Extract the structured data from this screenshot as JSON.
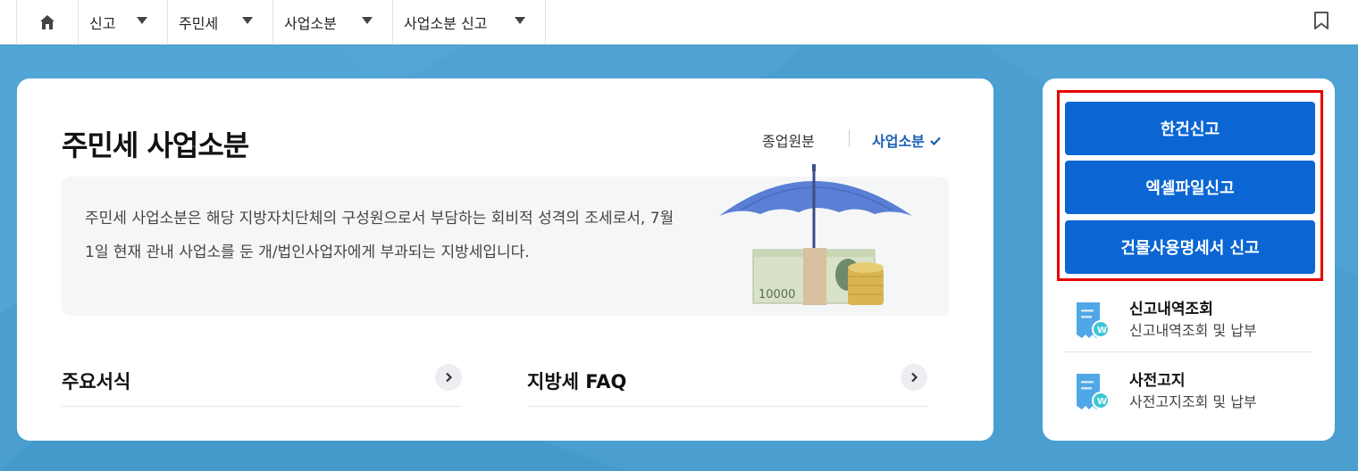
{
  "nav": {
    "items": [
      {
        "label": "신고"
      },
      {
        "label": "주민세"
      },
      {
        "label": "사업소분"
      },
      {
        "label": "사업소분 신고"
      }
    ]
  },
  "main": {
    "title": "주민세 사업소분",
    "tabs": [
      {
        "label": "종업원분",
        "selected": false
      },
      {
        "label": "사업소분",
        "selected": true
      }
    ],
    "description": "주민세 사업소분은 해당 지방자치단체의 구성원으로서 부담하는 회비적 성격의 조세로서, 7월 1일 현재 관내 사업소를 둔 개/법인사업자에게 부과되는 지방세입니다.",
    "links": [
      {
        "label": "주요서식"
      },
      {
        "label": "지방세 FAQ"
      }
    ],
    "banknote_text": "10000"
  },
  "side": {
    "buttons": [
      {
        "label": "한건신고"
      },
      {
        "label": "엑셀파일신고"
      },
      {
        "label": "건물사용명세서 신고"
      }
    ],
    "items": [
      {
        "title": "신고내역조회",
        "subtitle": "신고내역조회 및 납부"
      },
      {
        "title": "사전고지",
        "subtitle": "사전고지조회 및 납부"
      }
    ]
  },
  "colors": {
    "accent": "#0b66d4",
    "background": "#4a9fd0",
    "highlight_border": "#e60000",
    "tab_active": "#1a5fb4"
  },
  "icons": [
    "home-icon",
    "chevron-down-icon",
    "bookmark-icon",
    "check-icon",
    "chevron-right-icon",
    "receipt-icon"
  ]
}
